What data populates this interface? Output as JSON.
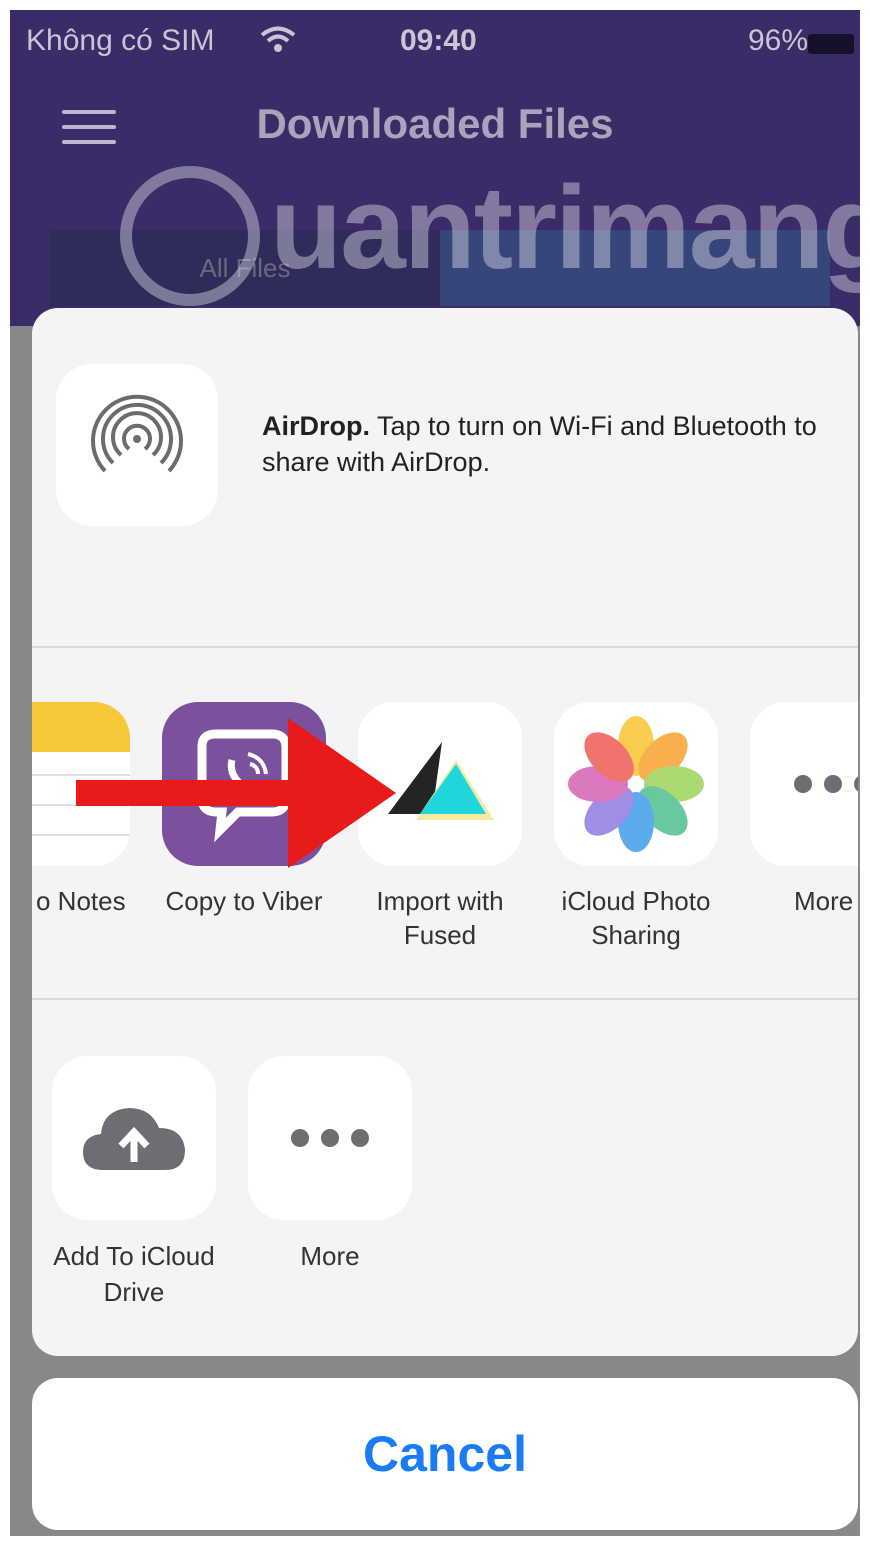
{
  "status_bar": {
    "carrier": "Không có SIM",
    "time": "09:40",
    "battery": "96%"
  },
  "header": {
    "title": "Downloaded Files",
    "tab_all_files": "All Files"
  },
  "watermark": {
    "text": "uantrimang"
  },
  "airdrop": {
    "title": "AirDrop.",
    "description": " Tap to turn on Wi-Fi and Bluetooth to share with AirDrop."
  },
  "apps": [
    {
      "label": "o Notes",
      "icon": "notes-icon"
    },
    {
      "label": "Copy to Viber",
      "icon": "viber-icon"
    },
    {
      "label": "Import with Fused",
      "icon": "fused-icon"
    },
    {
      "label": "iCloud Photo Sharing",
      "icon": "photos-icon"
    },
    {
      "label": "More",
      "icon": "more-icon"
    }
  ],
  "actions": [
    {
      "label": "Add To iCloud Drive",
      "icon": "icloud-upload-icon"
    },
    {
      "label": "More",
      "icon": "more-icon"
    }
  ],
  "cancel_label": "Cancel",
  "colors": {
    "header_bg": "#3b2b66",
    "accent_blue": "#1a7cf5",
    "arrow_red": "#e81a1a",
    "viber_purple": "#7b519d"
  }
}
